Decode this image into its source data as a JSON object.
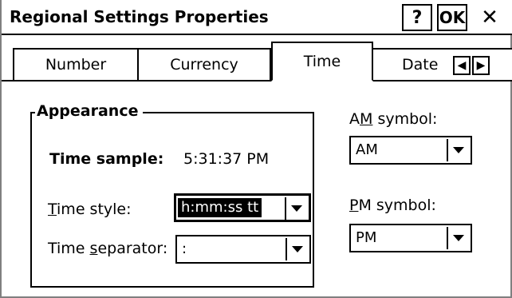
{
  "window": {
    "title": "Regional Settings Properties",
    "help_label": "?",
    "ok_label": "OK",
    "close_label": "✕"
  },
  "tabs": [
    {
      "label": "Number",
      "active": false
    },
    {
      "label": "Currency",
      "active": false
    },
    {
      "label": "Time",
      "active": true
    },
    {
      "label": "Date",
      "active": false
    }
  ],
  "tab_scroll": {
    "left": "◀",
    "right": "▶"
  },
  "appearance": {
    "legend": "Appearance",
    "time_sample_label": "Time sample:",
    "time_sample_value": "5:31:37 PM",
    "time_style_label_pre": "",
    "time_style_label_mnemonic": "T",
    "time_style_label_post": "ime style:",
    "time_style_value": "h:mm:ss tt",
    "time_separator_label_pre": "Time ",
    "time_separator_label_mnemonic": "s",
    "time_separator_label_post": "eparator:",
    "time_separator_value": ":"
  },
  "am": {
    "label_pre": "A",
    "label_mnemonic": "M",
    "label_post": " symbol:",
    "value": "AM"
  },
  "pm": {
    "label_pre": "",
    "label_mnemonic": "P",
    "label_post": "M symbol:",
    "value": "PM"
  }
}
